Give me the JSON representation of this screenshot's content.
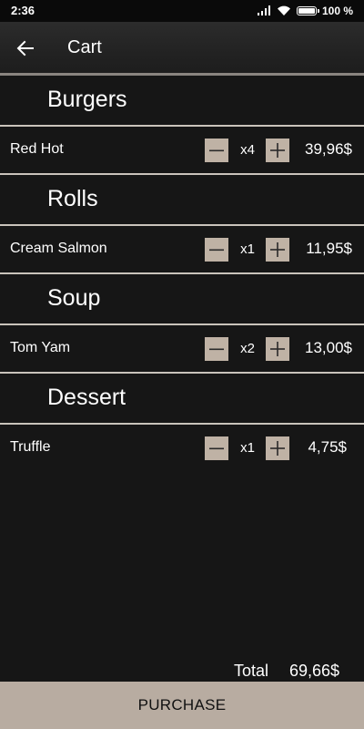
{
  "status_bar": {
    "time": "2:36",
    "battery": "100 %",
    "icons": [
      "signal-icon",
      "wifi-icon",
      "battery-icon"
    ]
  },
  "app_bar": {
    "back_icon": "arrow-left-icon",
    "title": "Cart"
  },
  "categories": [
    {
      "title": "Burgers",
      "items": [
        {
          "name": "Red Hot",
          "quantity": "x4",
          "price": "39,96$"
        }
      ]
    },
    {
      "title": "Rolls",
      "items": [
        {
          "name": "Cream Salmon",
          "quantity": "x1",
          "price": "11,95$"
        }
      ]
    },
    {
      "title": "Soup",
      "items": [
        {
          "name": "Tom Yam",
          "quantity": "x2",
          "price": "13,00$"
        }
      ]
    },
    {
      "title": "Dessert",
      "items": [
        {
          "name": "Truffle",
          "quantity": "x1",
          "price": "4,75$"
        }
      ]
    }
  ],
  "summary": {
    "total_label": "Total",
    "total_value": "69,66$"
  },
  "purchase": {
    "label": "PURCHASE"
  },
  "colors": {
    "background": "#161616",
    "button": "#b8aca1",
    "stepper": "#bfb2a5",
    "separator": "#c9c3bb"
  }
}
